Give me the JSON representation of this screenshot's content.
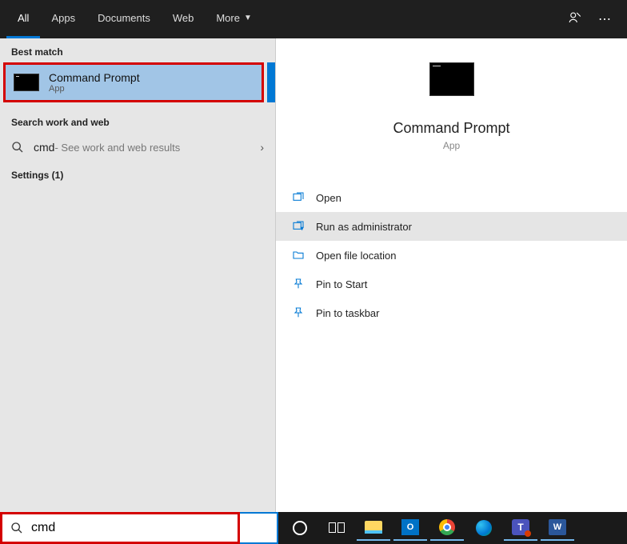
{
  "tabs": [
    "All",
    "Apps",
    "Documents",
    "Web",
    "More"
  ],
  "active_tab": "All",
  "sections": {
    "best_match": "Best match",
    "search_web": "Search work and web",
    "settings": "Settings (1)"
  },
  "best_match_item": {
    "title": "Command Prompt",
    "subtitle": "App"
  },
  "web_row": {
    "query": "cmd",
    "hint": " - See work and web results"
  },
  "preview": {
    "title": "Command Prompt",
    "subtitle": "App"
  },
  "actions": [
    {
      "label": "Open",
      "icon": "open"
    },
    {
      "label": "Run as administrator",
      "icon": "admin",
      "hover": true
    },
    {
      "label": "Open file location",
      "icon": "folder"
    },
    {
      "label": "Pin to Start",
      "icon": "pin"
    },
    {
      "label": "Pin to taskbar",
      "icon": "pin"
    }
  ],
  "search_value": "cmd"
}
